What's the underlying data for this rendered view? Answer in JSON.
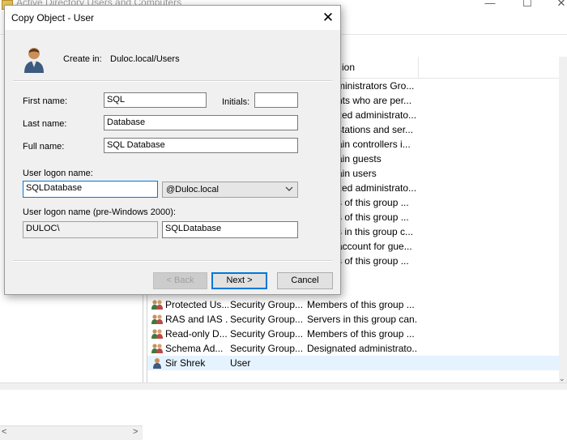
{
  "background_window": {
    "title": "Active Directory Users and Computers",
    "list": {
      "description_header": "ion",
      "partial_descriptions": [
        "ministrators Gro...",
        "nts who are per...",
        "zed administrato...",
        "stations and ser...",
        "ain controllers i...",
        "ain guests",
        "ain users",
        "zed administrato...",
        "s of this group ...",
        "s of this group ...",
        "s in this group c...",
        "account for gue...",
        "s of this group ..."
      ],
      "rows": [
        {
          "name": "Protected Us...",
          "type": "Security Group...",
          "description": "Members of this group ...",
          "icon": "group-icon"
        },
        {
          "name": "RAS and IAS ...",
          "type": "Security Group...",
          "description": "Servers in this group can...",
          "icon": "group-icon"
        },
        {
          "name": "Read-only D...",
          "type": "Security Group...",
          "description": "Members of this group ...",
          "icon": "group-icon"
        },
        {
          "name": "Schema Ad...",
          "type": "Security Group...",
          "description": "Designated administrato...",
          "icon": "group-icon"
        },
        {
          "name": "Sir Shrek",
          "type": "User",
          "description": "",
          "icon": "user-icon",
          "selected": true
        }
      ]
    }
  },
  "dialog": {
    "title": "Copy Object - User",
    "create_in_label": "Create in:",
    "create_in_value": "Duloc.local/Users",
    "first_name_label": "First name:",
    "first_name_value": "SQL",
    "initials_label": "Initials:",
    "initials_value": "",
    "last_name_label": "Last name:",
    "last_name_value": "Database",
    "full_name_label": "Full name:",
    "full_name_value": "SQL Database",
    "logon_name_label": "User logon name:",
    "logon_name_value": "SQLDatabase",
    "domain_value": "@Duloc.local",
    "pre2000_label": "User logon name (pre-Windows 2000):",
    "pre2000_domain_value": "DULOC\\",
    "pre2000_name_value": "SQLDatabase",
    "back_label": "< Back",
    "next_label": "Next >",
    "cancel_label": "Cancel"
  },
  "colors": {
    "accent": "#0078d7",
    "dialog_bg": "#f0f0f0",
    "selected_row": "#e5f3ff"
  }
}
